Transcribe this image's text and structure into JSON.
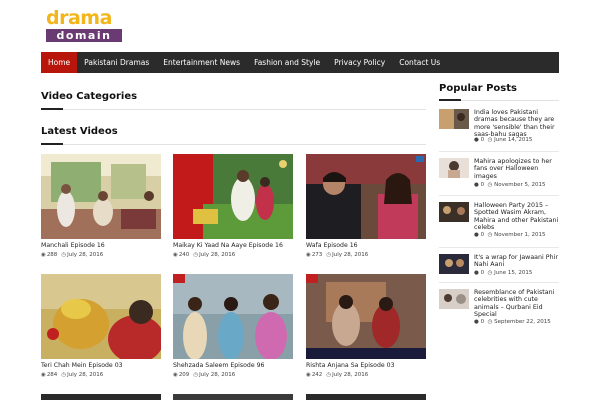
{
  "logo": {
    "line1": "drama",
    "line2": "domain"
  },
  "nav": [
    {
      "label": "Home",
      "active": true
    },
    {
      "label": "Pakistani Dramas",
      "active": false
    },
    {
      "label": "Entertainment News",
      "active": false
    },
    {
      "label": "Fashion and Style",
      "active": false
    },
    {
      "label": "Privacy Policy",
      "active": false
    },
    {
      "label": "Contact Us",
      "active": false
    }
  ],
  "sections": {
    "video_categories": "Video Categories",
    "latest_videos": "Latest Videos",
    "popular_posts": "Popular Posts"
  },
  "videos": [
    {
      "title": "Manchali Episode 16",
      "views": "288",
      "date": "July 28, 2016"
    },
    {
      "title": "Maikay Ki Yaad Na Aaye Episode 16",
      "views": "240",
      "date": "July 28, 2016"
    },
    {
      "title": "Wafa Episode 16",
      "views": "273",
      "date": "July 28, 2016"
    },
    {
      "title": "Teri Chah Mein Episode 03",
      "views": "284",
      "date": "July 28, 2016"
    },
    {
      "title": "Shehzada Saleem Episode 96",
      "views": "209",
      "date": "July 28, 2016"
    },
    {
      "title": "Rishta Anjana Sa Episode 03",
      "views": "242",
      "date": "July 28, 2016"
    }
  ],
  "popular": [
    {
      "title": "India loves Pakistani dramas because they are more 'sensible' than their saas-bahu sagas",
      "comments": "0",
      "date": "June 14, 2015"
    },
    {
      "title": "Mahira apologizes to her fans over Halloween images",
      "comments": "0",
      "date": "November 5, 2015"
    },
    {
      "title": "Halloween Party 2015 – Spotted Wasim Akram, Mahira and other Pakistani celebs",
      "comments": "0",
      "date": "November 1, 2015"
    },
    {
      "title": "It's a wrap for Jawaani Phir Nahi Aani",
      "comments": "0",
      "date": "June 15, 2015"
    },
    {
      "title": "Resemblance of Pakistani celebrities with cute animals – Qurbani Eid Special",
      "comments": "0",
      "date": "September 22, 2015"
    }
  ],
  "colors": {
    "nav_bg": "#2b2b2b",
    "nav_active": "#b8160b",
    "logo_yellow": "#f2b51a",
    "logo_purple": "#6a3a72"
  },
  "icons": {
    "views": "eye-icon",
    "date": "clock-icon",
    "comments": "comment-icon"
  }
}
